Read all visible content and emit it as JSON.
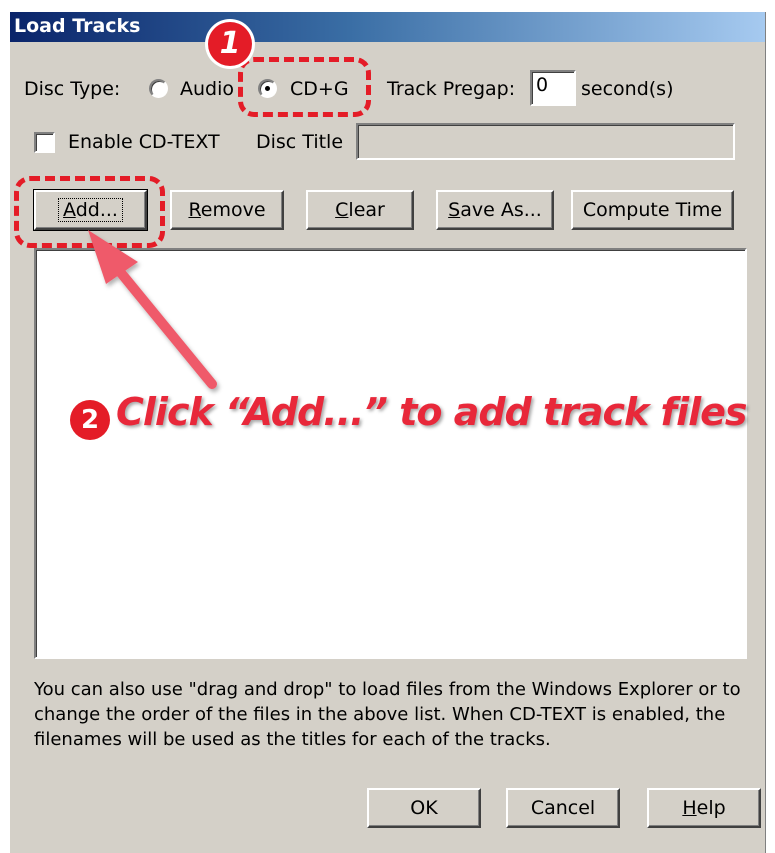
{
  "window": {
    "title": "Load Tracks"
  },
  "disc_type": {
    "label": "Disc Type:",
    "options": [
      "Audio",
      "CD+G"
    ],
    "selected": "CD+G"
  },
  "pregap": {
    "label": "Track Pregap:",
    "value": "0",
    "unit": "second(s)"
  },
  "cdtext": {
    "label": "Enable CD-TEXT",
    "checked": false,
    "disc_title_label": "Disc Title",
    "disc_title_value": ""
  },
  "buttons": {
    "add": {
      "pre": "",
      "key": "A",
      "post": "dd..."
    },
    "remove": {
      "pre": "",
      "key": "R",
      "post": "emove"
    },
    "clear": {
      "pre": "",
      "key": "C",
      "post": "lear"
    },
    "save_as": {
      "pre": "",
      "key": "S",
      "post": "ave As..."
    },
    "compute_time": {
      "label": "Compute Time"
    },
    "ok": {
      "label": "OK"
    },
    "cancel": {
      "label": "Cancel"
    },
    "help": {
      "pre": "",
      "key": "H",
      "post": "elp"
    }
  },
  "track_list": [],
  "description": "You can also use \"drag and drop\" to load files from the Windows Explorer or to change the order of the files in the above list. When CD-TEXT is enabled, the filenames will be used as the titles for each of the tracks.",
  "annotations": {
    "step1_number": "1",
    "step2_number": "2",
    "step2_text": "Click “Add...” to add track files",
    "color": "#e41c27"
  }
}
